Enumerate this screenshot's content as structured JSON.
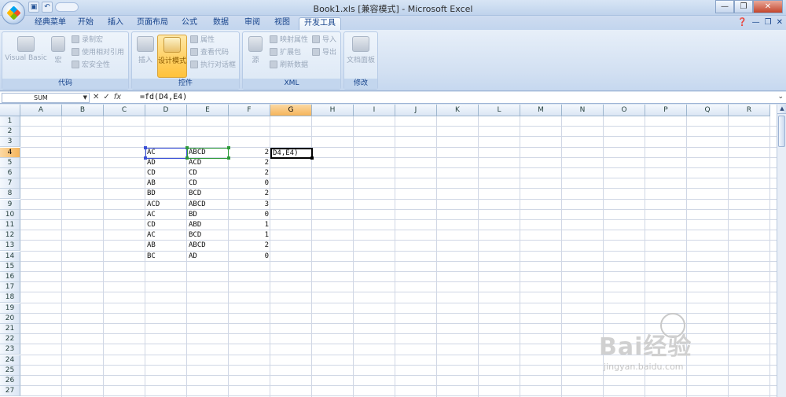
{
  "window": {
    "title": "Book1.xls  [兼容模式] - Microsoft Excel",
    "qat_undo": "↶",
    "qat_save": "▣"
  },
  "tabs": [
    {
      "label": "经典菜单"
    },
    {
      "label": "开始"
    },
    {
      "label": "插入"
    },
    {
      "label": "页面布局"
    },
    {
      "label": "公式"
    },
    {
      "label": "数据"
    },
    {
      "label": "审阅"
    },
    {
      "label": "视图"
    },
    {
      "label": "开发工具",
      "active": true
    }
  ],
  "ribbon": {
    "code": {
      "label": "代码",
      "visual_basic": "Visual Basic",
      "macro": "宏",
      "record_macro": "录制宏",
      "relative_ref": "使用相对引用",
      "macro_security": "宏安全性"
    },
    "controls": {
      "label": "控件",
      "insert": "插入",
      "design_mode": "设计模式",
      "properties": "属性",
      "view_code": "查看代码",
      "run_dialog": "执行对话框"
    },
    "xml": {
      "label": "XML",
      "source": "源",
      "map_properties": "映射属性",
      "expansion_packs": "扩展包",
      "refresh_data": "刷新数据",
      "import": "导入",
      "export": "导出"
    },
    "modify": {
      "label": "修改",
      "doc_panel": "文档面板"
    }
  },
  "formula_bar": {
    "name_box": "SUM",
    "formula": "=fd(D4,E4)"
  },
  "columns": [
    "A",
    "B",
    "C",
    "D",
    "E",
    "F",
    "G",
    "H",
    "I",
    "J",
    "K",
    "L",
    "M",
    "N",
    "O",
    "P",
    "Q",
    "R"
  ],
  "selected_column": "G",
  "selected_row": 4,
  "rows": [
    "1",
    "2",
    "3",
    "4",
    "5",
    "6",
    "7",
    "8",
    "9",
    "10",
    "11",
    "12",
    "13",
    "14",
    "15",
    "16",
    "17",
    "18",
    "19",
    "20",
    "21",
    "22",
    "23",
    "24",
    "25",
    "26",
    "27"
  ],
  "cells": {
    "D": [
      "AC",
      "AD",
      "CD",
      "AB",
      "BD",
      "ACD",
      "AC",
      "CD",
      "AC",
      "AB",
      "BC"
    ],
    "E": [
      "ABCD",
      "ACD",
      "CD",
      "CD",
      "BCD",
      "ABCD",
      "BD",
      "ABD",
      "BCD",
      "ABCD",
      "AD"
    ],
    "F": [
      "2",
      "2",
      "2",
      "0",
      "2",
      "3",
      "0",
      "1",
      "1",
      "2",
      "0"
    ]
  },
  "editing_cell": {
    "address": "G4",
    "text": "D4,E4)"
  },
  "watermark": {
    "brand": "Bai经验",
    "url": "jingyan.baidu.com"
  }
}
